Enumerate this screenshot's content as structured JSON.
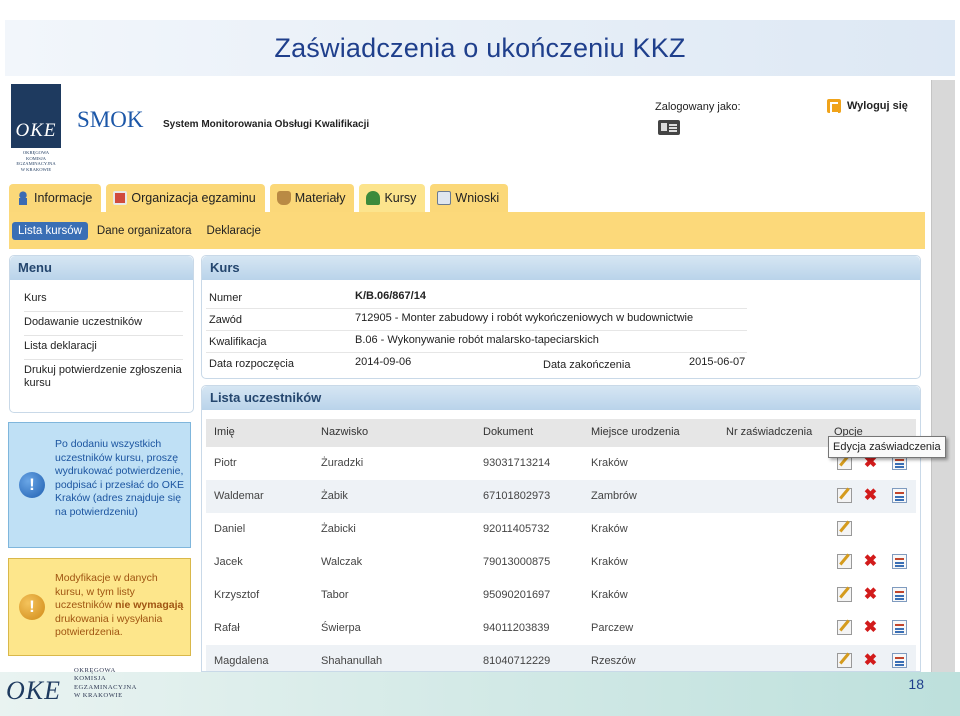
{
  "slide": {
    "title": "Zaświadczenia o ukończeniu KKZ",
    "page_number": "18"
  },
  "header": {
    "logo_text": "OKE",
    "logo_subtitle": [
      "OKRĘGOWA",
      "KOMISJA",
      "EGZAMINACYJNA",
      "W KRAKOWIE"
    ],
    "app_name": "SMOK",
    "app_subtitle": "System Monitorowania Obsługi Kwalifikacji",
    "logged_in_label": "Zalogowany jako:",
    "logout_label": "Wyloguj się"
  },
  "tabs": [
    {
      "label": "Informacje",
      "icon": "person-info-icon"
    },
    {
      "label": "Organizacja egzaminu",
      "icon": "calendar-icon"
    },
    {
      "label": "Materiały",
      "icon": "bag-icon"
    },
    {
      "label": "Kursy",
      "icon": "tree-icon",
      "active": true
    },
    {
      "label": "Wnioski",
      "icon": "document-icon"
    }
  ],
  "subnav": [
    {
      "label": "Lista kursów",
      "active": true
    },
    {
      "label": "Dane organizatora"
    },
    {
      "label": "Deklaracje"
    }
  ],
  "menu": {
    "title": "Menu",
    "items": [
      "Kurs",
      "Dodawanie uczestników",
      "Lista deklaracji",
      "Drukuj potwierdzenie zgłoszenia kursu"
    ]
  },
  "kurs": {
    "title": "Kurs",
    "numer_label": "Numer",
    "numer_value": "K/B.06/867/14",
    "zawod_label": "Zawód",
    "zawod_value": "712905 - Monter zabudowy i robót wykończeniowych w budownictwie",
    "kwalifikacja_label": "Kwalifikacja",
    "kwalifikacja_value": "B.06 - Wykonywanie robót malarsko-tapeciarskich",
    "data_rozp_label": "Data rozpoczęcia",
    "data_rozp_value": "2014-09-06",
    "data_zak_label": "Data zakończenia",
    "data_zak_value": "2015-06-07"
  },
  "info_blue": {
    "text": "Po dodaniu wszystkich uczestników kursu, proszę wydrukować potwierdzenie, podpisać i przesłać do OKE Kraków (adres znajduje się na potwierdzeniu)"
  },
  "info_yellow": {
    "text_before": "Modyfikacje w danych kursu, w tym listy uczestników ",
    "text_bold": "nie wymagają",
    "text_after": " drukowania i wysyłania potwierdzenia."
  },
  "participants": {
    "title": "Lista uczestników",
    "columns": [
      "Imię",
      "Nazwisko",
      "Dokument",
      "Miejsce urodzenia",
      "Nr zaświadczenia",
      "Opcje"
    ],
    "rows": [
      {
        "imie": "Piotr",
        "nazwisko": "Żuradzki",
        "dokument": "93031713214",
        "miejsce": "Kraków",
        "nr": ""
      },
      {
        "imie": "Waldemar",
        "nazwisko": "Żabik",
        "dokument": "67101802973",
        "miejsce": "Zambrów",
        "nr": ""
      },
      {
        "imie": "Daniel",
        "nazwisko": "Żabicki",
        "dokument": "92011405732",
        "miejsce": "Kraków",
        "nr": ""
      },
      {
        "imie": "Jacek",
        "nazwisko": "Walczak",
        "dokument": "79013000875",
        "miejsce": "Kraków",
        "nr": ""
      },
      {
        "imie": "Krzysztof",
        "nazwisko": "Tabor",
        "dokument": "95090201697",
        "miejsce": "Kraków",
        "nr": ""
      },
      {
        "imie": "Rafał",
        "nazwisko": "Świerpa",
        "dokument": "94011203839",
        "miejsce": "Parczew",
        "nr": ""
      },
      {
        "imie": "Magdalena",
        "nazwisko": "Shahanullah",
        "dokument": "81040712229",
        "miejsce": "Rzeszów",
        "nr": ""
      }
    ],
    "tooltip": "Edycja zaświadczenia"
  },
  "footer": {
    "logo_text": "OKE",
    "logo_lines": [
      "OKRĘGOWA",
      "KOMISJA",
      "EGZAMINACYJNA",
      "W KRAKOWIE"
    ]
  },
  "colors": {
    "tab_bg": "#fbd879",
    "subnav_active": "#3a6fb5",
    "title_text": "#1f3f8c",
    "delete": "#d21b1b"
  }
}
